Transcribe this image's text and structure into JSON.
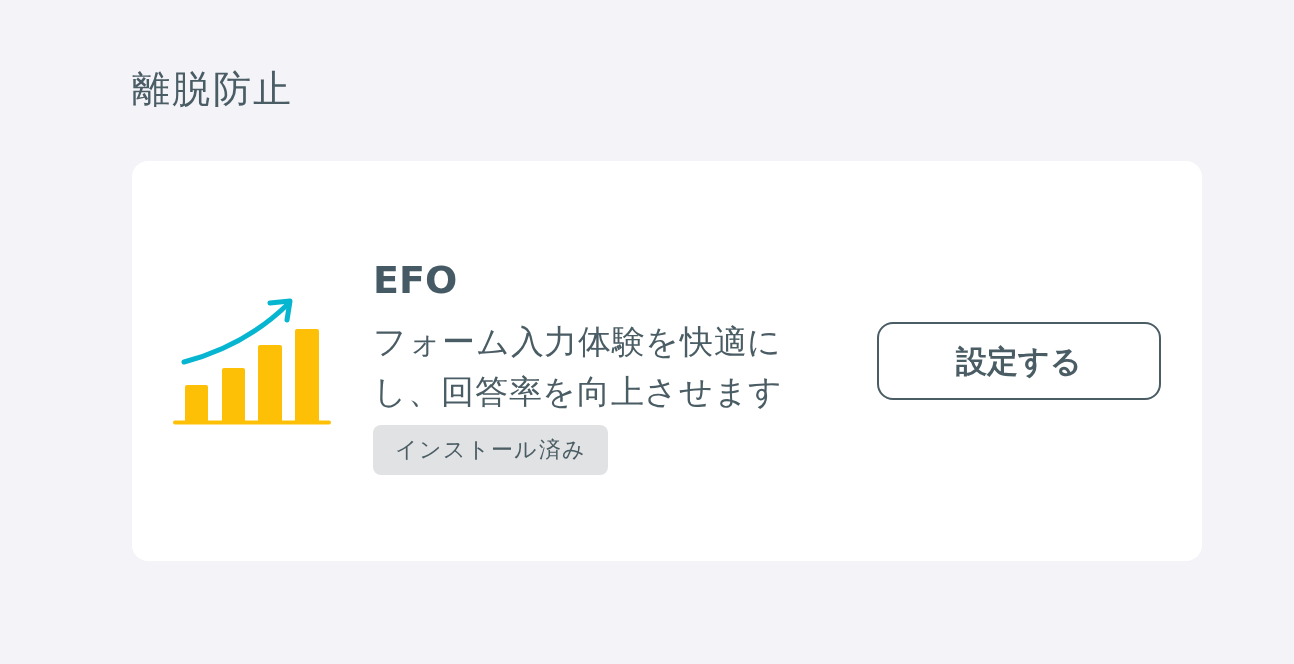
{
  "section_title": "離脱防止",
  "apps": [
    {
      "name": "EFO",
      "description": "フォーム入力体験を快適にし、回答率を向上させます",
      "badge": "インストール済み",
      "action_button": "設定する"
    }
  ]
}
